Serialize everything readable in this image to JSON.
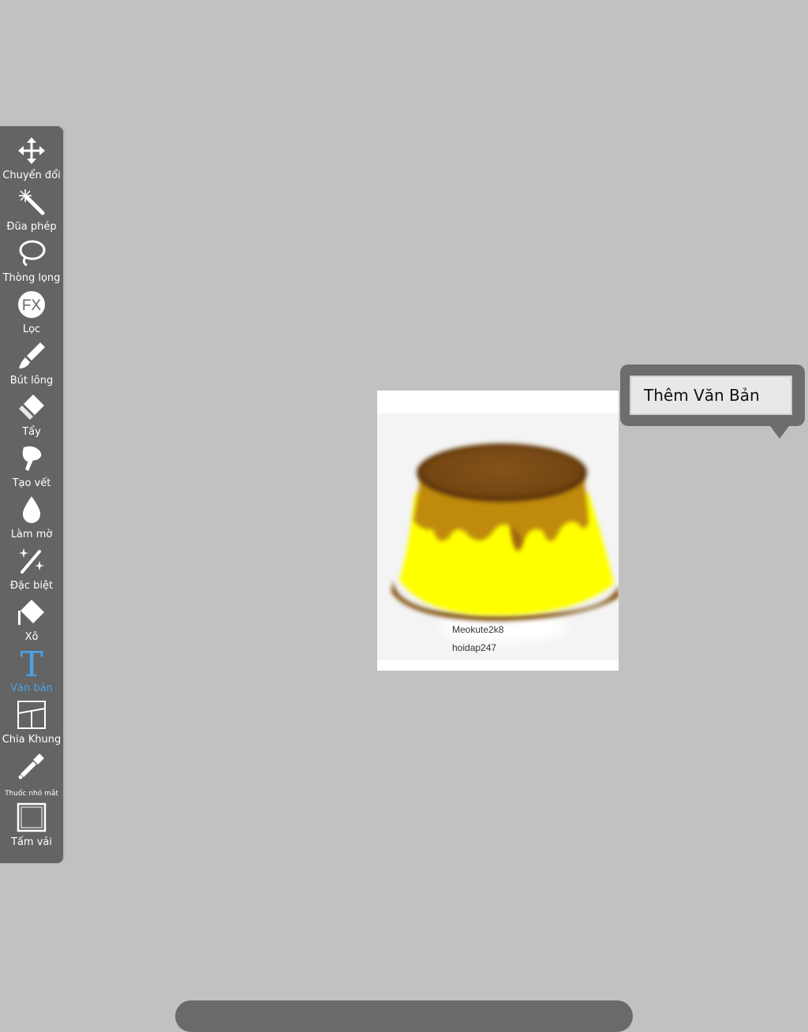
{
  "toolbar": {
    "tools": [
      {
        "label": "Chuyển đổi",
        "icon": "move-icon"
      },
      {
        "label": "Đũa phép",
        "icon": "magic-wand-icon"
      },
      {
        "label": "Thòng lọng",
        "icon": "lasso-icon"
      },
      {
        "label": "Lọc",
        "icon": "fx-filter-icon",
        "icon_text": "FX"
      },
      {
        "label": "Bút lông",
        "icon": "brush-icon"
      },
      {
        "label": "Tẩy",
        "icon": "eraser-icon"
      },
      {
        "label": "Tạo vết",
        "icon": "smudge-icon"
      },
      {
        "label": "Làm mờ",
        "icon": "blur-drop-icon"
      },
      {
        "label": "Đặc biệt",
        "icon": "special-sparkle-icon"
      },
      {
        "label": "Xô",
        "icon": "bucket-icon"
      },
      {
        "label": "Văn bản",
        "icon": "text-icon",
        "icon_text": "T",
        "active": true
      },
      {
        "label": "Chia Khung",
        "icon": "frame-divider-icon"
      },
      {
        "label": "Thuốc nhỏ mắt",
        "icon": "eyedropper-icon"
      },
      {
        "label": "Tấm vải",
        "icon": "canvas-icon"
      }
    ],
    "active_color": "#4aa3e8"
  },
  "canvas": {
    "watermark_1": "Meokute2k8",
    "watermark_2": "hoidap247"
  },
  "popup": {
    "add_text_label": "Thêm Văn Bản"
  },
  "colors": {
    "background": "#c1c1c1",
    "toolbar": "#646464",
    "pudding_yellow": "#ffff00",
    "caramel": "#8b5a00"
  }
}
